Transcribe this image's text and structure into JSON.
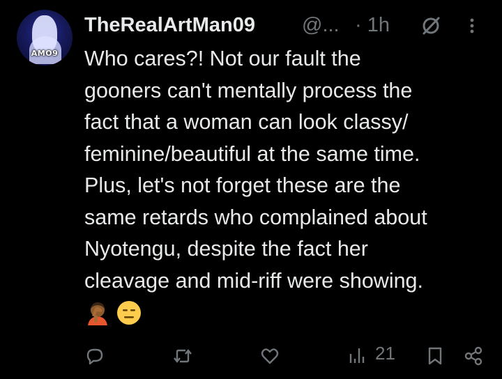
{
  "tweet": {
    "avatar_label": "AMO9",
    "display_name": "TheRealArtMan09",
    "handle": "@...",
    "time": "· 1h",
    "lines": [
      "Who cares?! Not our fault the",
      "gooners can't mentally process the",
      "fact that a woman can look classy/",
      "feminine/beautiful at the same time.",
      "Plus, let's not forget these are the",
      "same retards who complained about",
      "Nyotengu, despite the fact her",
      "cleavage and mid-riff were showing."
    ],
    "emojis": [
      "facepalm-emoji",
      "expressionless-face-emoji"
    ]
  },
  "actions": {
    "reply_icon": "reply-icon",
    "repost_icon": "repost-icon",
    "like_icon": "heart-icon",
    "views_icon": "views-icon",
    "views_count": "21",
    "bookmark_icon": "bookmark-icon",
    "share_icon": "share-icon"
  },
  "colors": {
    "background": "#000000",
    "text": "#e7e9ea",
    "muted": "#71767b"
  }
}
